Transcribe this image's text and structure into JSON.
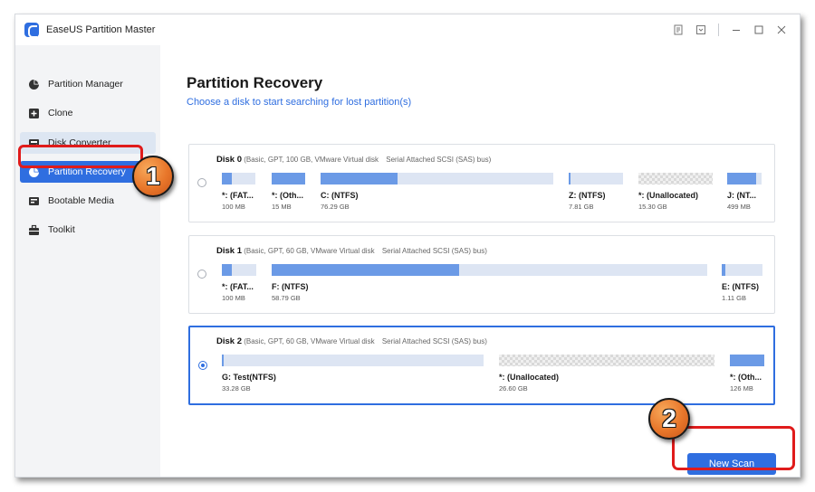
{
  "app": {
    "title": "EaseUS Partition Master"
  },
  "titlebar": {
    "icons": [
      "notes-icon",
      "download-icon",
      "minimize-icon",
      "maximize-icon",
      "close-icon"
    ]
  },
  "sidebar": {
    "items": [
      {
        "label": "Partition Manager",
        "icon": "pie-chart-icon"
      },
      {
        "label": "Clone",
        "icon": "clone-icon"
      },
      {
        "label": "Disk Converter",
        "icon": "disk-icon"
      },
      {
        "label": "Partition Recovery",
        "icon": "recovery-pie-icon"
      },
      {
        "label": "Bootable Media",
        "icon": "media-icon"
      },
      {
        "label": "Toolkit",
        "icon": "toolbox-icon"
      }
    ]
  },
  "main": {
    "title": "Partition Recovery",
    "subtitle": "Choose a disk to start searching for lost partition(s)"
  },
  "disks": [
    {
      "name": "Disk 0",
      "info": "(Basic, GPT, 100 GB, VMware   Virtual disk",
      "bus": "Serial Attached SCSI (SAS) bus)",
      "selected": false,
      "partitions": [
        {
          "name": "*: (FAT...",
          "size": "100 MB",
          "used_fraction": 0.3
        },
        {
          "name": "*: (Oth...",
          "size": "15 MB",
          "used_fraction": 1.0
        },
        {
          "name": "C: (NTFS)",
          "size": "76.29 GB",
          "used_fraction": 0.33
        },
        {
          "name": "Z: (NTFS)",
          "size": "7.81 GB",
          "used_fraction": 0.03
        },
        {
          "name": "*: (Unallocated)",
          "size": "15.30 GB",
          "unallocated": true
        },
        {
          "name": "J: (NT...",
          "size": "499 MB",
          "used_fraction": 0.85
        }
      ]
    },
    {
      "name": "Disk 1",
      "info": "(Basic, GPT, 60 GB, VMware   Virtual disk",
      "bus": "Serial Attached SCSI (SAS) bus)",
      "selected": false,
      "partitions": [
        {
          "name": "*: (FAT...",
          "size": "100 MB",
          "used_fraction": 0.3
        },
        {
          "name": "F: (NTFS)",
          "size": "58.79 GB",
          "used_fraction": 0.43
        },
        {
          "name": "E: (NTFS)",
          "size": "1.11 GB",
          "used_fraction": 0.08
        }
      ]
    },
    {
      "name": "Disk 2",
      "info": "(Basic, GPT, 60 GB, VMware   Virtual disk",
      "bus": "Serial Attached SCSI (SAS) bus)",
      "selected": true,
      "partitions": [
        {
          "name": "G: Test(NTFS)",
          "size": "33.28 GB",
          "used_fraction": 0.006
        },
        {
          "name": "*: (Unallocated)",
          "size": "26.60 GB",
          "unallocated": true
        },
        {
          "name": "*: (Oth...",
          "size": "126 MB",
          "used_fraction": 1.0
        }
      ]
    }
  ],
  "actions": {
    "scan_label": "New Scan"
  },
  "callouts": {
    "step1": "1",
    "step2": "2"
  },
  "colors": {
    "accent": "#2f6ee0",
    "callout_red": "#e01b1b",
    "badge_orange": "#e8762a"
  }
}
